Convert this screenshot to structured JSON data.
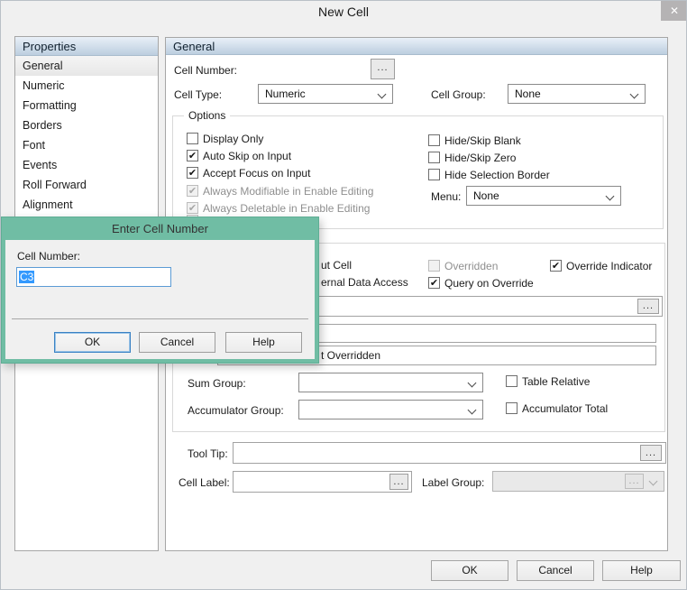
{
  "window": {
    "title": "New Cell",
    "close_glyph": "✕"
  },
  "colors": {
    "modal_accent": "#70bda4",
    "selection_blue": "#3399fe",
    "header_gradient_top": "#e9f0f8",
    "header_gradient_bottom": "#bccedf"
  },
  "sidebar": {
    "header": "Properties",
    "items": [
      {
        "label": "General",
        "selected": true
      },
      {
        "label": "Numeric",
        "selected": false
      },
      {
        "label": "Formatting",
        "selected": false
      },
      {
        "label": "Borders",
        "selected": false
      },
      {
        "label": "Font",
        "selected": false
      },
      {
        "label": "Events",
        "selected": false
      },
      {
        "label": "Roll Forward",
        "selected": false
      },
      {
        "label": "Alignment",
        "selected": false
      }
    ]
  },
  "general_panel": {
    "header": "General",
    "ellipsis": "...",
    "fields": {
      "cell_number_label": "Cell Number:",
      "cell_type_label": "Cell Type:",
      "cell_type_value": "Numeric",
      "cell_group_label": "Cell Group:",
      "cell_group_value": "None",
      "tool_tip_label": "Tool Tip:",
      "tool_tip_value": "",
      "cell_label_label": "Cell Label:",
      "cell_label_value": "",
      "label_group_label": "Label Group:",
      "label_group_value": ""
    },
    "options_group": {
      "title": "Options",
      "left_checkboxes": [
        {
          "label": "Display Only",
          "checked": false,
          "disabled": false
        },
        {
          "label": "Auto Skip on Input",
          "checked": true,
          "disabled": false
        },
        {
          "label": "Accept Focus on Input",
          "checked": true,
          "disabled": false
        },
        {
          "label": "Always Modifiable in Enable Editing",
          "checked": true,
          "disabled": true
        },
        {
          "label": "Always Deletable in Enable Editing",
          "checked": true,
          "disabled": true
        }
      ],
      "right_checkboxes": [
        {
          "label": "Hide/Skip Blank",
          "checked": false
        },
        {
          "label": "Hide/Skip Zero",
          "checked": false
        },
        {
          "label": "Hide Selection Border",
          "checked": false
        }
      ],
      "menu_label": "Menu:",
      "menu_value": "None"
    },
    "override_group": {
      "row1_visible_fragment": "ut Cell",
      "overridden_label": "Overridden",
      "overridden_checked": false,
      "overridden_disabled": true,
      "override_indicator_label": "Override Indicator",
      "override_indicator_checked": true,
      "row2_visible_fragment": "ernal Data Access",
      "query_on_override_label": "Query on Override",
      "query_on_override_checked": true,
      "textbox_visible_fragment": "t Overridden",
      "sum_group_label": "Sum Group:",
      "sum_group_value": "",
      "table_relative_label": "Table Relative",
      "table_relative_checked": false,
      "accumulator_group_label": "Accumulator Group:",
      "accumulator_group_value": "",
      "accumulator_total_label": "Accumulator Total",
      "accumulator_total_checked": false
    }
  },
  "modal": {
    "title": "Enter Cell Number",
    "cell_number_label": "Cell Number:",
    "cell_number_value": "C3",
    "ok_label": "OK",
    "cancel_label": "Cancel",
    "help_label": "Help"
  },
  "footer": {
    "ok_label": "OK",
    "cancel_label": "Cancel",
    "help_label": "Help"
  }
}
